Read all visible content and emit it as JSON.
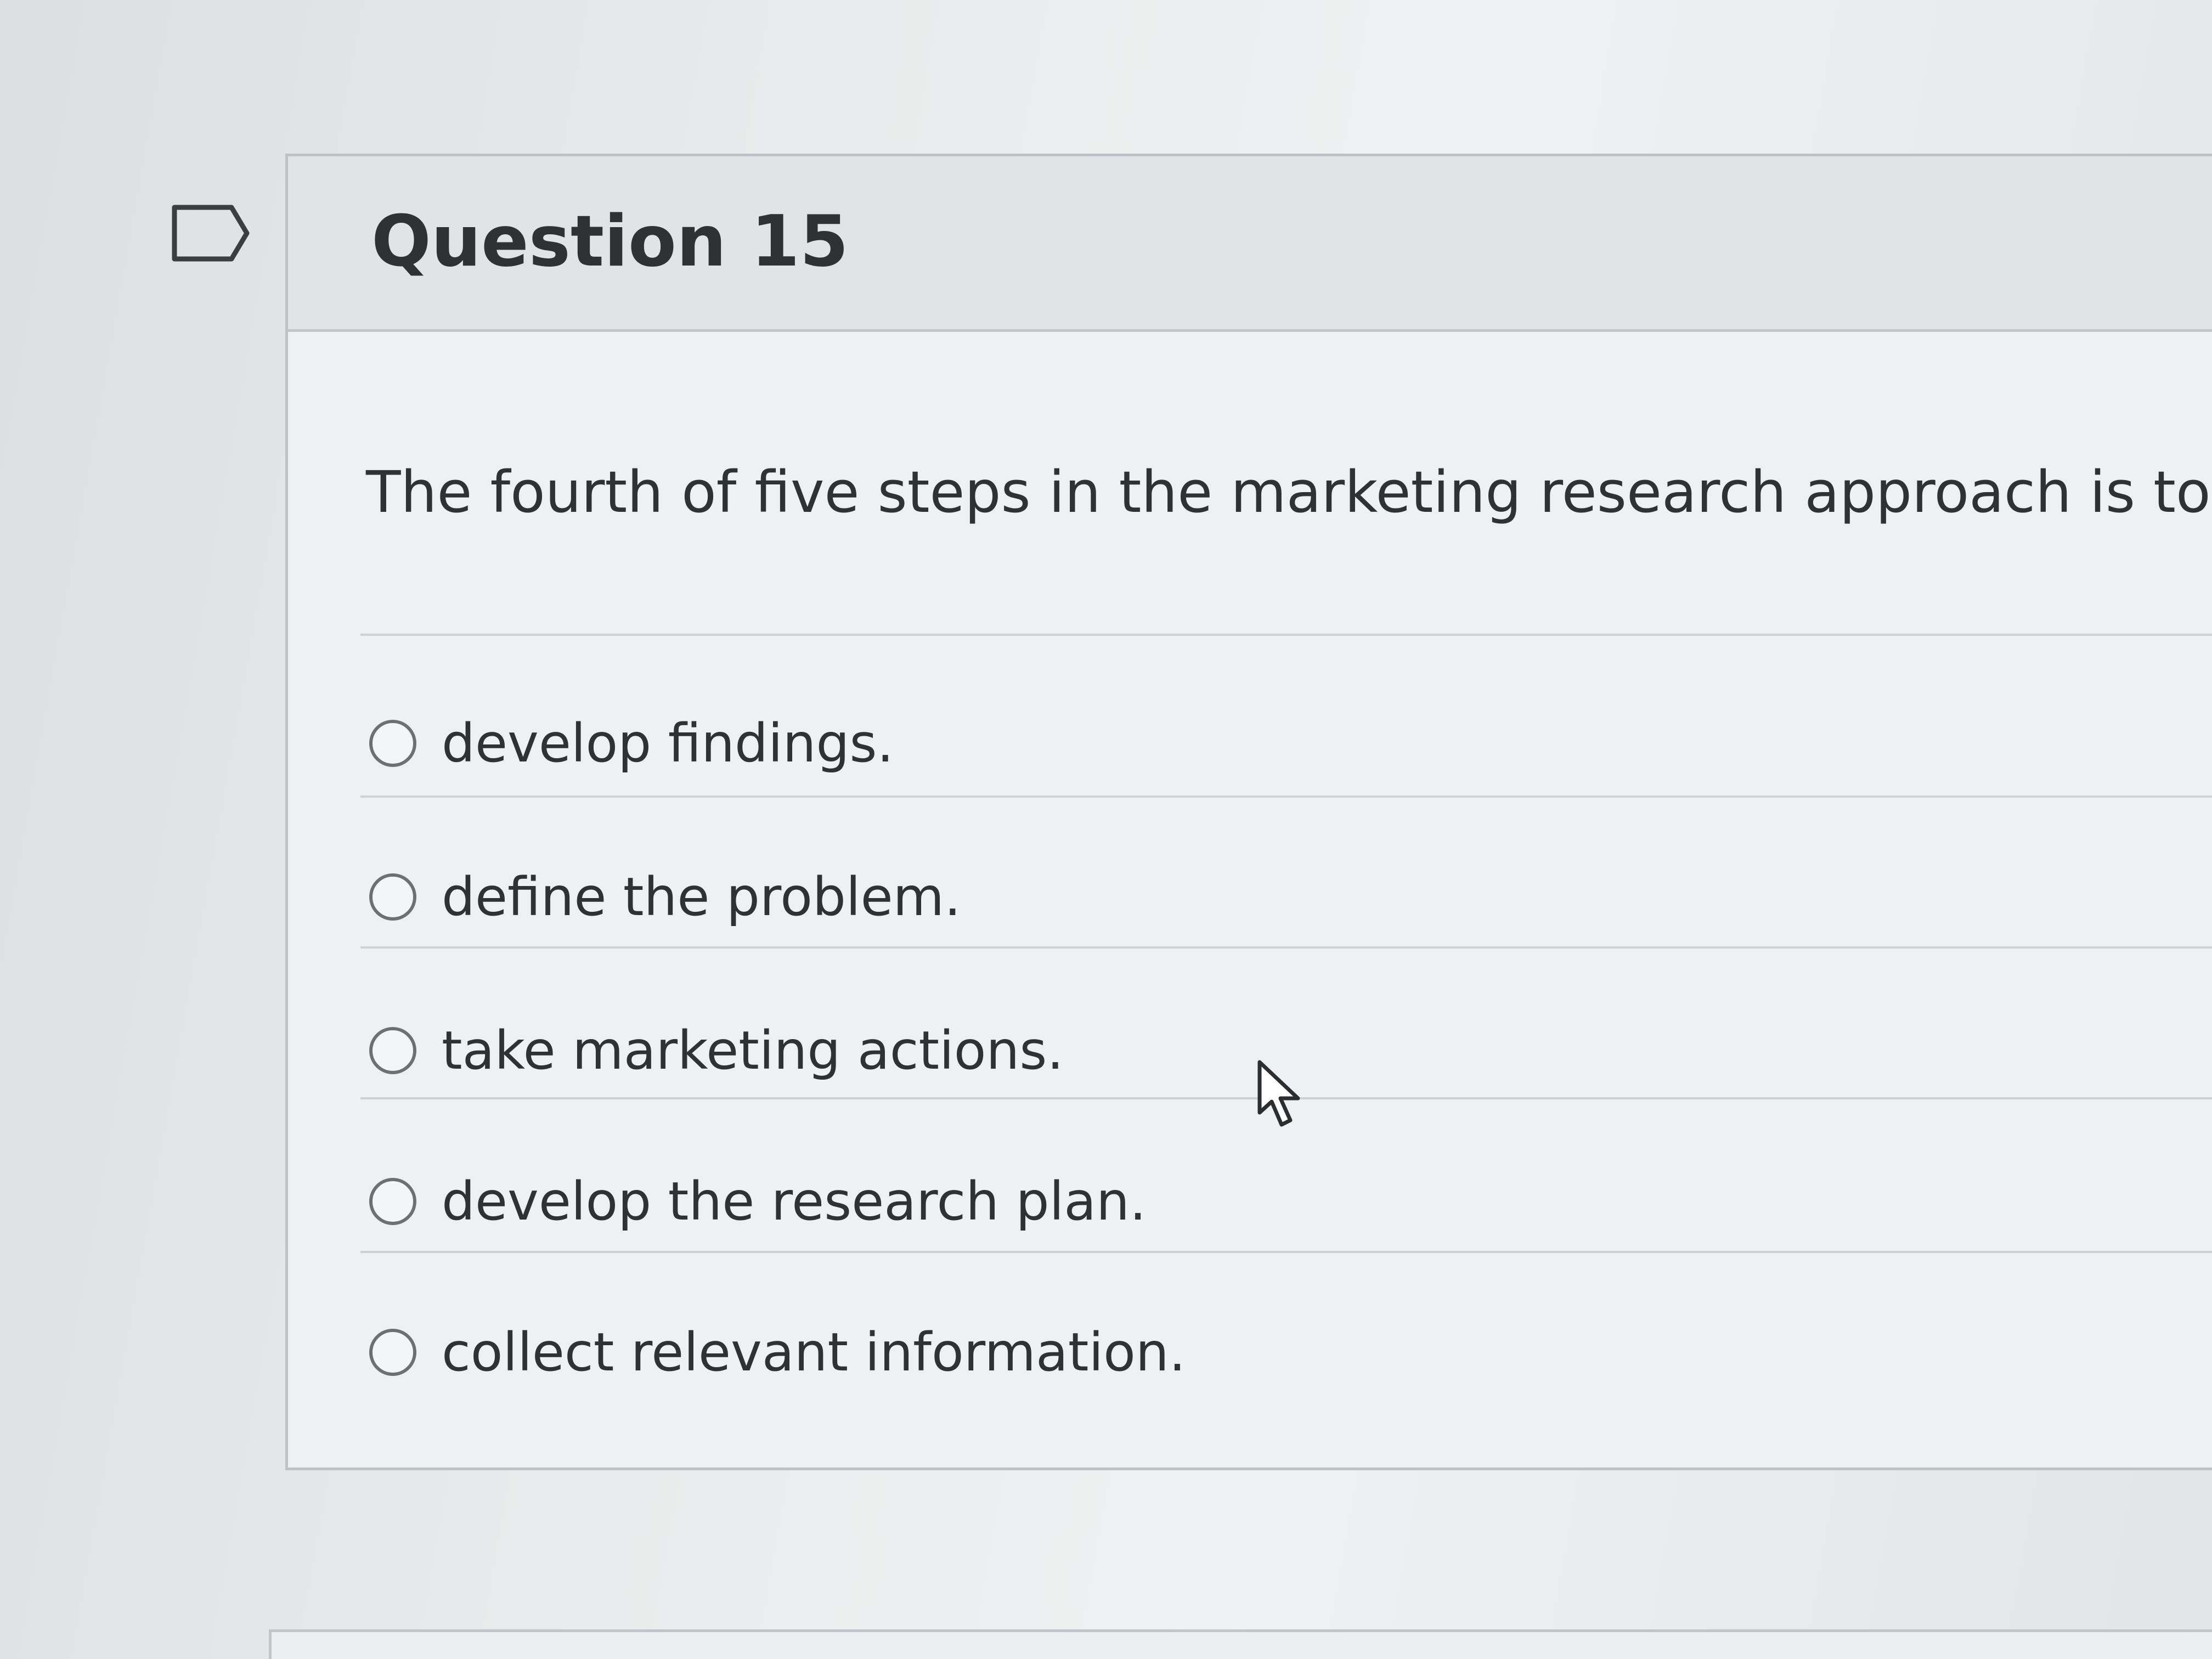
{
  "question": {
    "title": "Question 15",
    "prompt": "The fourth of five steps in the marketing research approach is to",
    "options": [
      {
        "label": "develop findings."
      },
      {
        "label": "define the problem."
      },
      {
        "label": "take marketing actions."
      },
      {
        "label": "develop the research plan."
      },
      {
        "label": "collect relevant information."
      }
    ]
  },
  "icons": {
    "flag": "flag-icon",
    "cursor": "mouse-pointer-icon"
  }
}
